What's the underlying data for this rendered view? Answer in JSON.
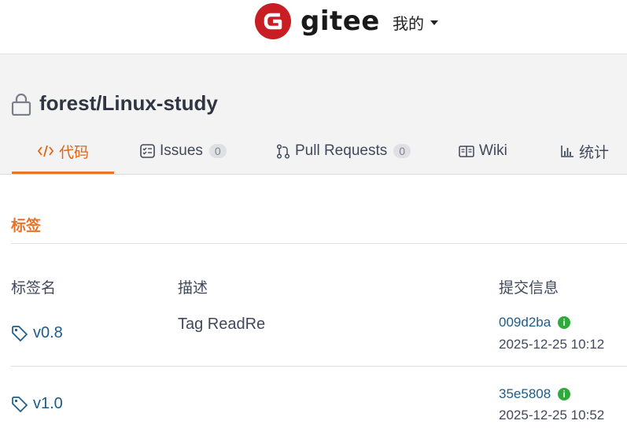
{
  "topbar": {
    "logo_text": "gitee",
    "menu_label": "我的"
  },
  "repo": {
    "name": "forest/Linux-study"
  },
  "tabs": [
    {
      "label": "代码"
    },
    {
      "label": "Issues",
      "count": "0"
    },
    {
      "label": "Pull Requests",
      "count": "0"
    },
    {
      "label": "Wiki"
    },
    {
      "label": "统计"
    }
  ],
  "section": {
    "title": "标签"
  },
  "table": {
    "headers": [
      "标签名",
      "描述",
      "提交信息"
    ],
    "rows": [
      {
        "tag": "v0.8",
        "description": "Tag ReadRe",
        "sha": "009d2ba",
        "date": "2025-12-25 10:12"
      },
      {
        "tag": "v1.0",
        "description": "",
        "sha": "35e5808",
        "date": "2025-12-25 10:52"
      }
    ]
  },
  "colors": {
    "accent": "#e8742a",
    "brand": "#c71d23",
    "link": "#1c5c87",
    "verified": "#2cab3a"
  }
}
